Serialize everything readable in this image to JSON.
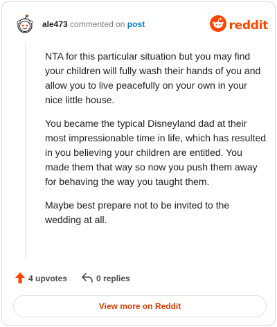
{
  "comment": {
    "username": "ale473",
    "action_text": "commented on",
    "post_link": "post",
    "paragraphs": [
      "NTA for this particular situation but you may find your children will fully wash their hands of you and allow you to live peacefully on your own in your nice little house.",
      "You became the typical Disneyland dad at their most impressionable time in life, which has resulted in you believing your children are entitled. You made them that way so now you push them away for behaving the way you taught them.",
      "Maybe best prepare not to be invited to the wedding at all."
    ]
  },
  "brand": {
    "wordmark": "reddit",
    "color": "#ff4500"
  },
  "actions": {
    "upvotes_label": "4 upvotes",
    "replies_label": "0 replies"
  },
  "footer": {
    "view_more_label": "View more on Reddit"
  },
  "icons": {
    "avatar": "snoo-avatar-icon",
    "logo": "reddit-logo-icon",
    "upvote": "upvote-arrow-icon",
    "reply": "reply-arrow-icon"
  }
}
